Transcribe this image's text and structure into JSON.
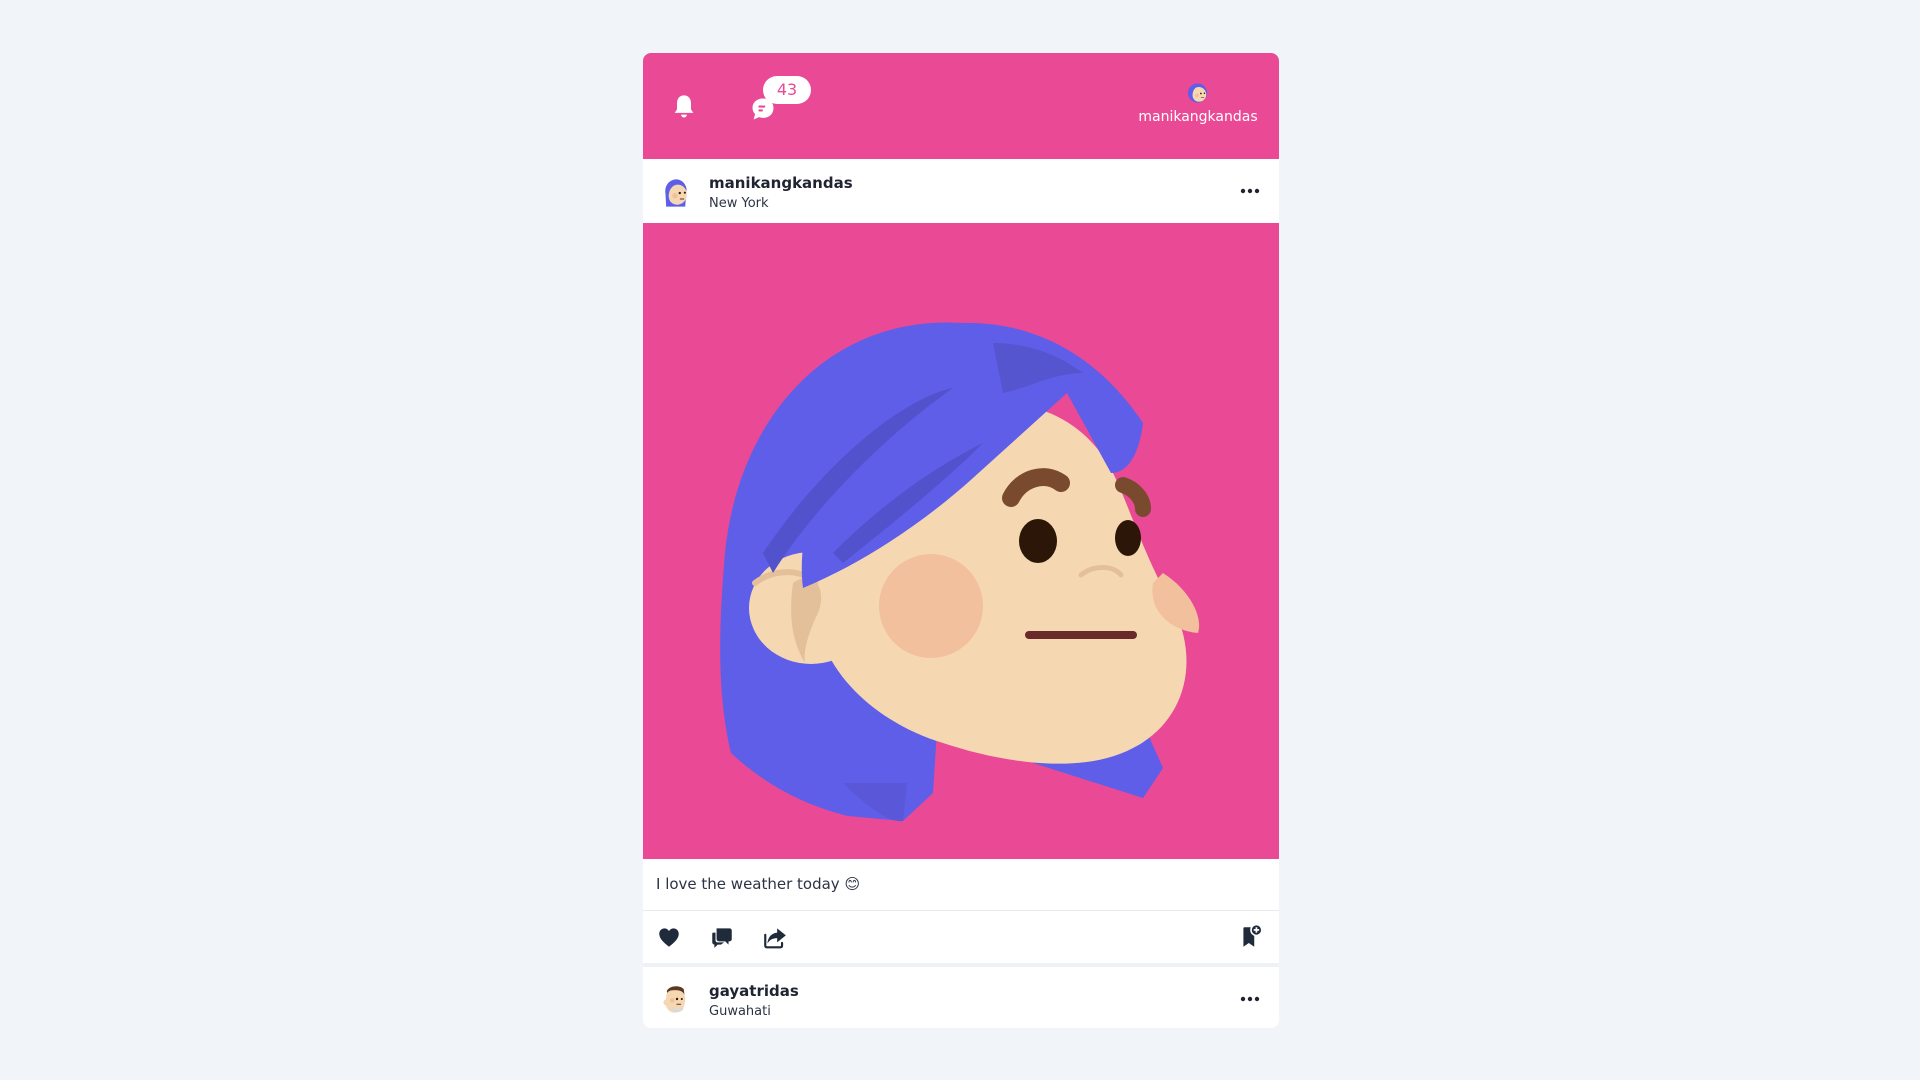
{
  "topbar": {
    "notification_count": "43",
    "profile_name": "manikangkandas",
    "icons": [
      "bell-icon",
      "chat-icon",
      "avatar"
    ]
  },
  "colors": {
    "accent": "#ea4a95",
    "hair": "#5e5ee8",
    "skin": "#f5d8b2",
    "cheek": "#f2c09d",
    "background": "#f1f4f8",
    "icon_dark": "#1f2a3a"
  },
  "posts": [
    {
      "username": "manikangkandas",
      "location": "New York",
      "caption": "I love the weather today",
      "caption_emoji": "😊",
      "actions": [
        "heart-icon",
        "comment-icon",
        "share-icon",
        "bookmark-add-icon"
      ],
      "menu": "more-dots-icon"
    },
    {
      "username": "gayatridas",
      "location": "Guwahati",
      "menu": "more-dots-icon"
    }
  ]
}
